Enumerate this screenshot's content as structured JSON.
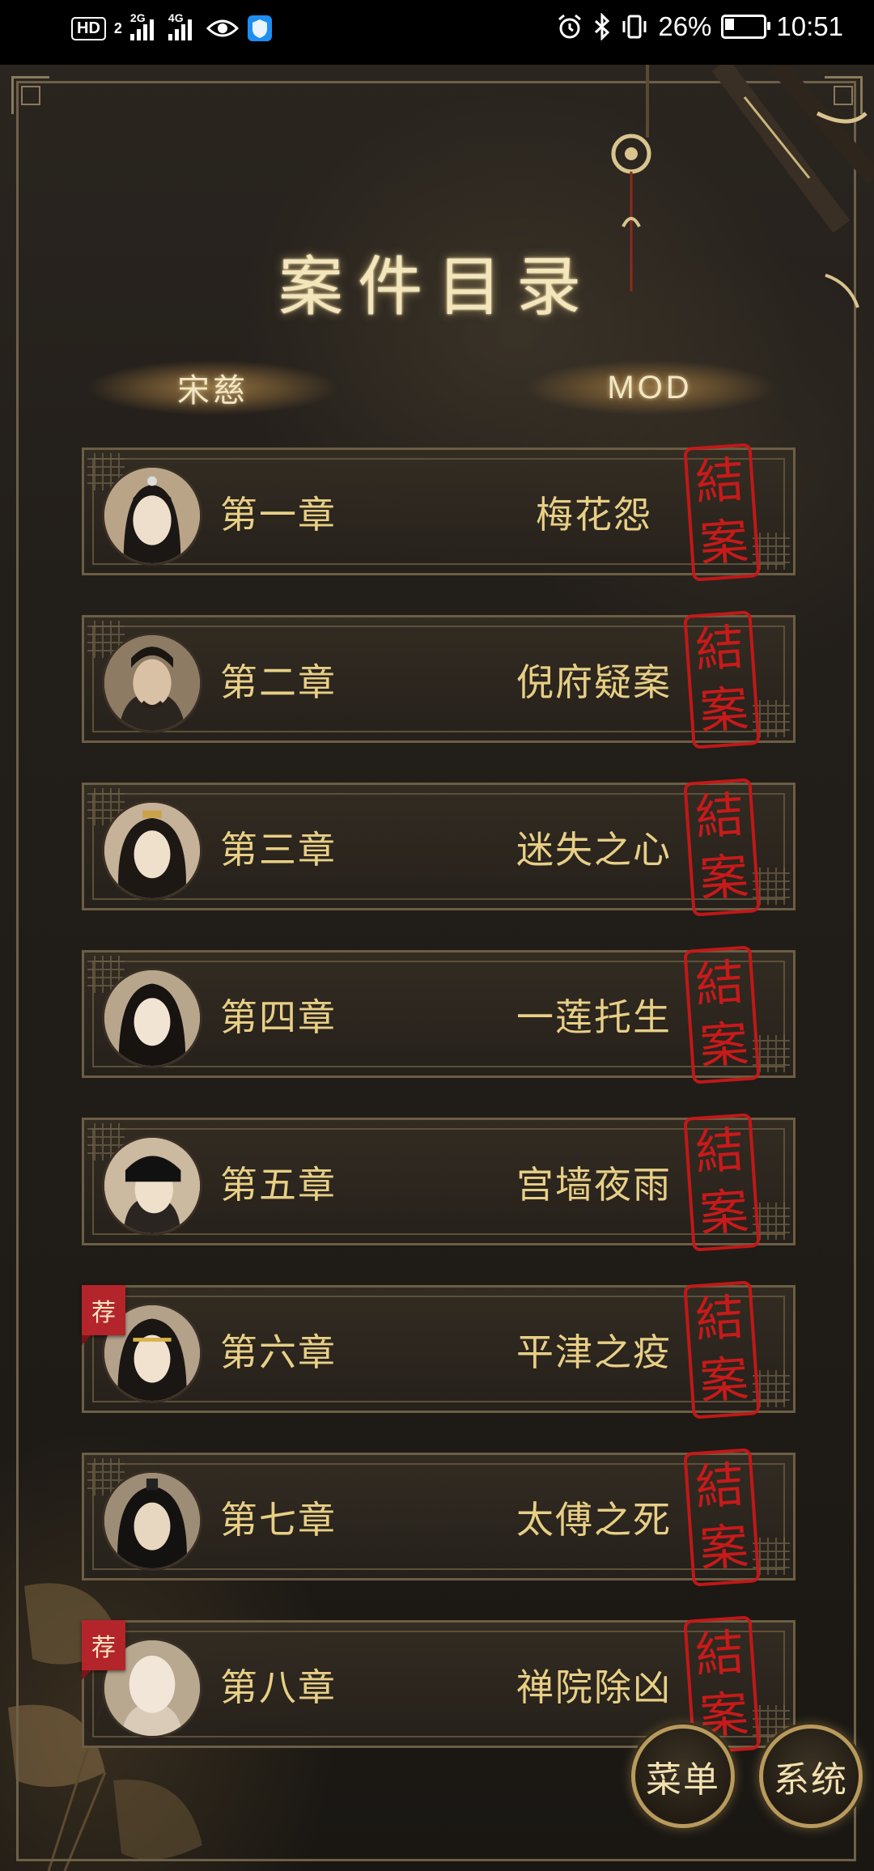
{
  "status_bar": {
    "hd": "HD",
    "sim": "2",
    "net1": "2G",
    "net2": "4G",
    "battery": "26%",
    "battery_level": 0.26,
    "time": "10:51",
    "icons": [
      "hd-icon",
      "signal-icon",
      "signal-icon",
      "eye-icon",
      "shield-icon",
      "alarm-icon",
      "bluetooth-icon",
      "vibrate-icon",
      "battery-icon"
    ]
  },
  "page": {
    "title": "案件目录",
    "tabs": [
      "宋慈",
      "MOD"
    ]
  },
  "chapters": [
    {
      "number": "第一章",
      "title": "梅花怨",
      "seal": [
        "結",
        "案"
      ],
      "recommended": false
    },
    {
      "number": "第二章",
      "title": "倪府疑案",
      "seal": [
        "結",
        "案"
      ],
      "recommended": false
    },
    {
      "number": "第三章",
      "title": "迷失之心",
      "seal": [
        "結",
        "案"
      ],
      "recommended": false
    },
    {
      "number": "第四章",
      "title": "一莲托生",
      "seal": [
        "結",
        "案"
      ],
      "recommended": false
    },
    {
      "number": "第五章",
      "title": "宫墙夜雨",
      "seal": [
        "結",
        "案"
      ],
      "recommended": false
    },
    {
      "number": "第六章",
      "title": "平津之疫",
      "seal": [
        "結",
        "案"
      ],
      "recommended": true,
      "tag": "荐"
    },
    {
      "number": "第七章",
      "title": "太傅之死",
      "seal": [
        "結",
        "案"
      ],
      "recommended": false
    },
    {
      "number": "第八章",
      "title": "禅院除凶",
      "seal": [
        "結",
        "案"
      ],
      "recommended": true,
      "tag": "荐"
    }
  ],
  "buttons": {
    "menu": "菜单",
    "system": "系统"
  },
  "colors": {
    "title_glow": "#f3e6bc",
    "chapter_text": "#e8cf86",
    "seal_red": "#d01a1a",
    "tag_red": "#b3252a",
    "frame_gold": "#6e6048"
  }
}
